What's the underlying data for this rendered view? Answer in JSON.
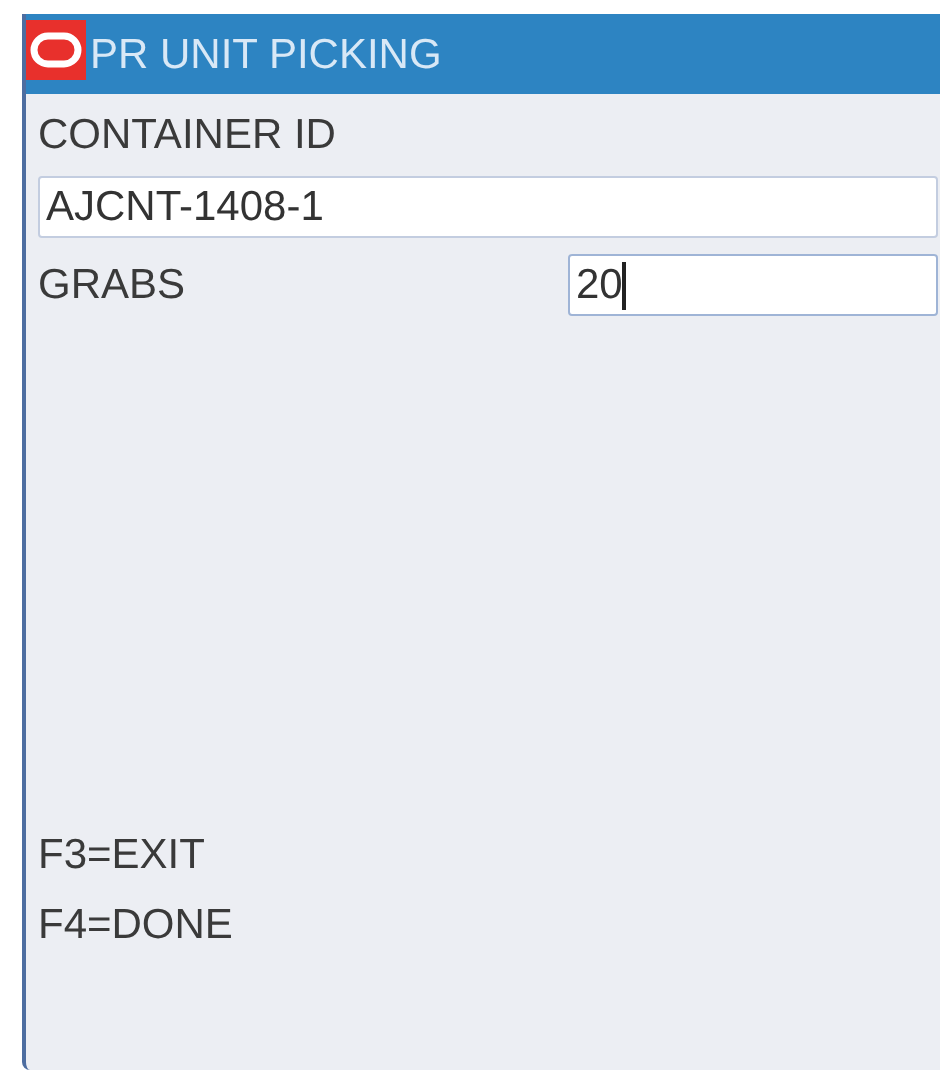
{
  "window": {
    "title": "PR UNIT PICKING"
  },
  "fields": [
    {
      "label": "CONTAINER ID",
      "value": "AJCNT-1408-1",
      "kind": "stacked",
      "focused": false
    },
    {
      "label": "GRABS",
      "value": "20",
      "kind": "inline",
      "focused": true
    }
  ],
  "function_keys": [
    "F3=EXIT",
    "F4=DONE"
  ]
}
